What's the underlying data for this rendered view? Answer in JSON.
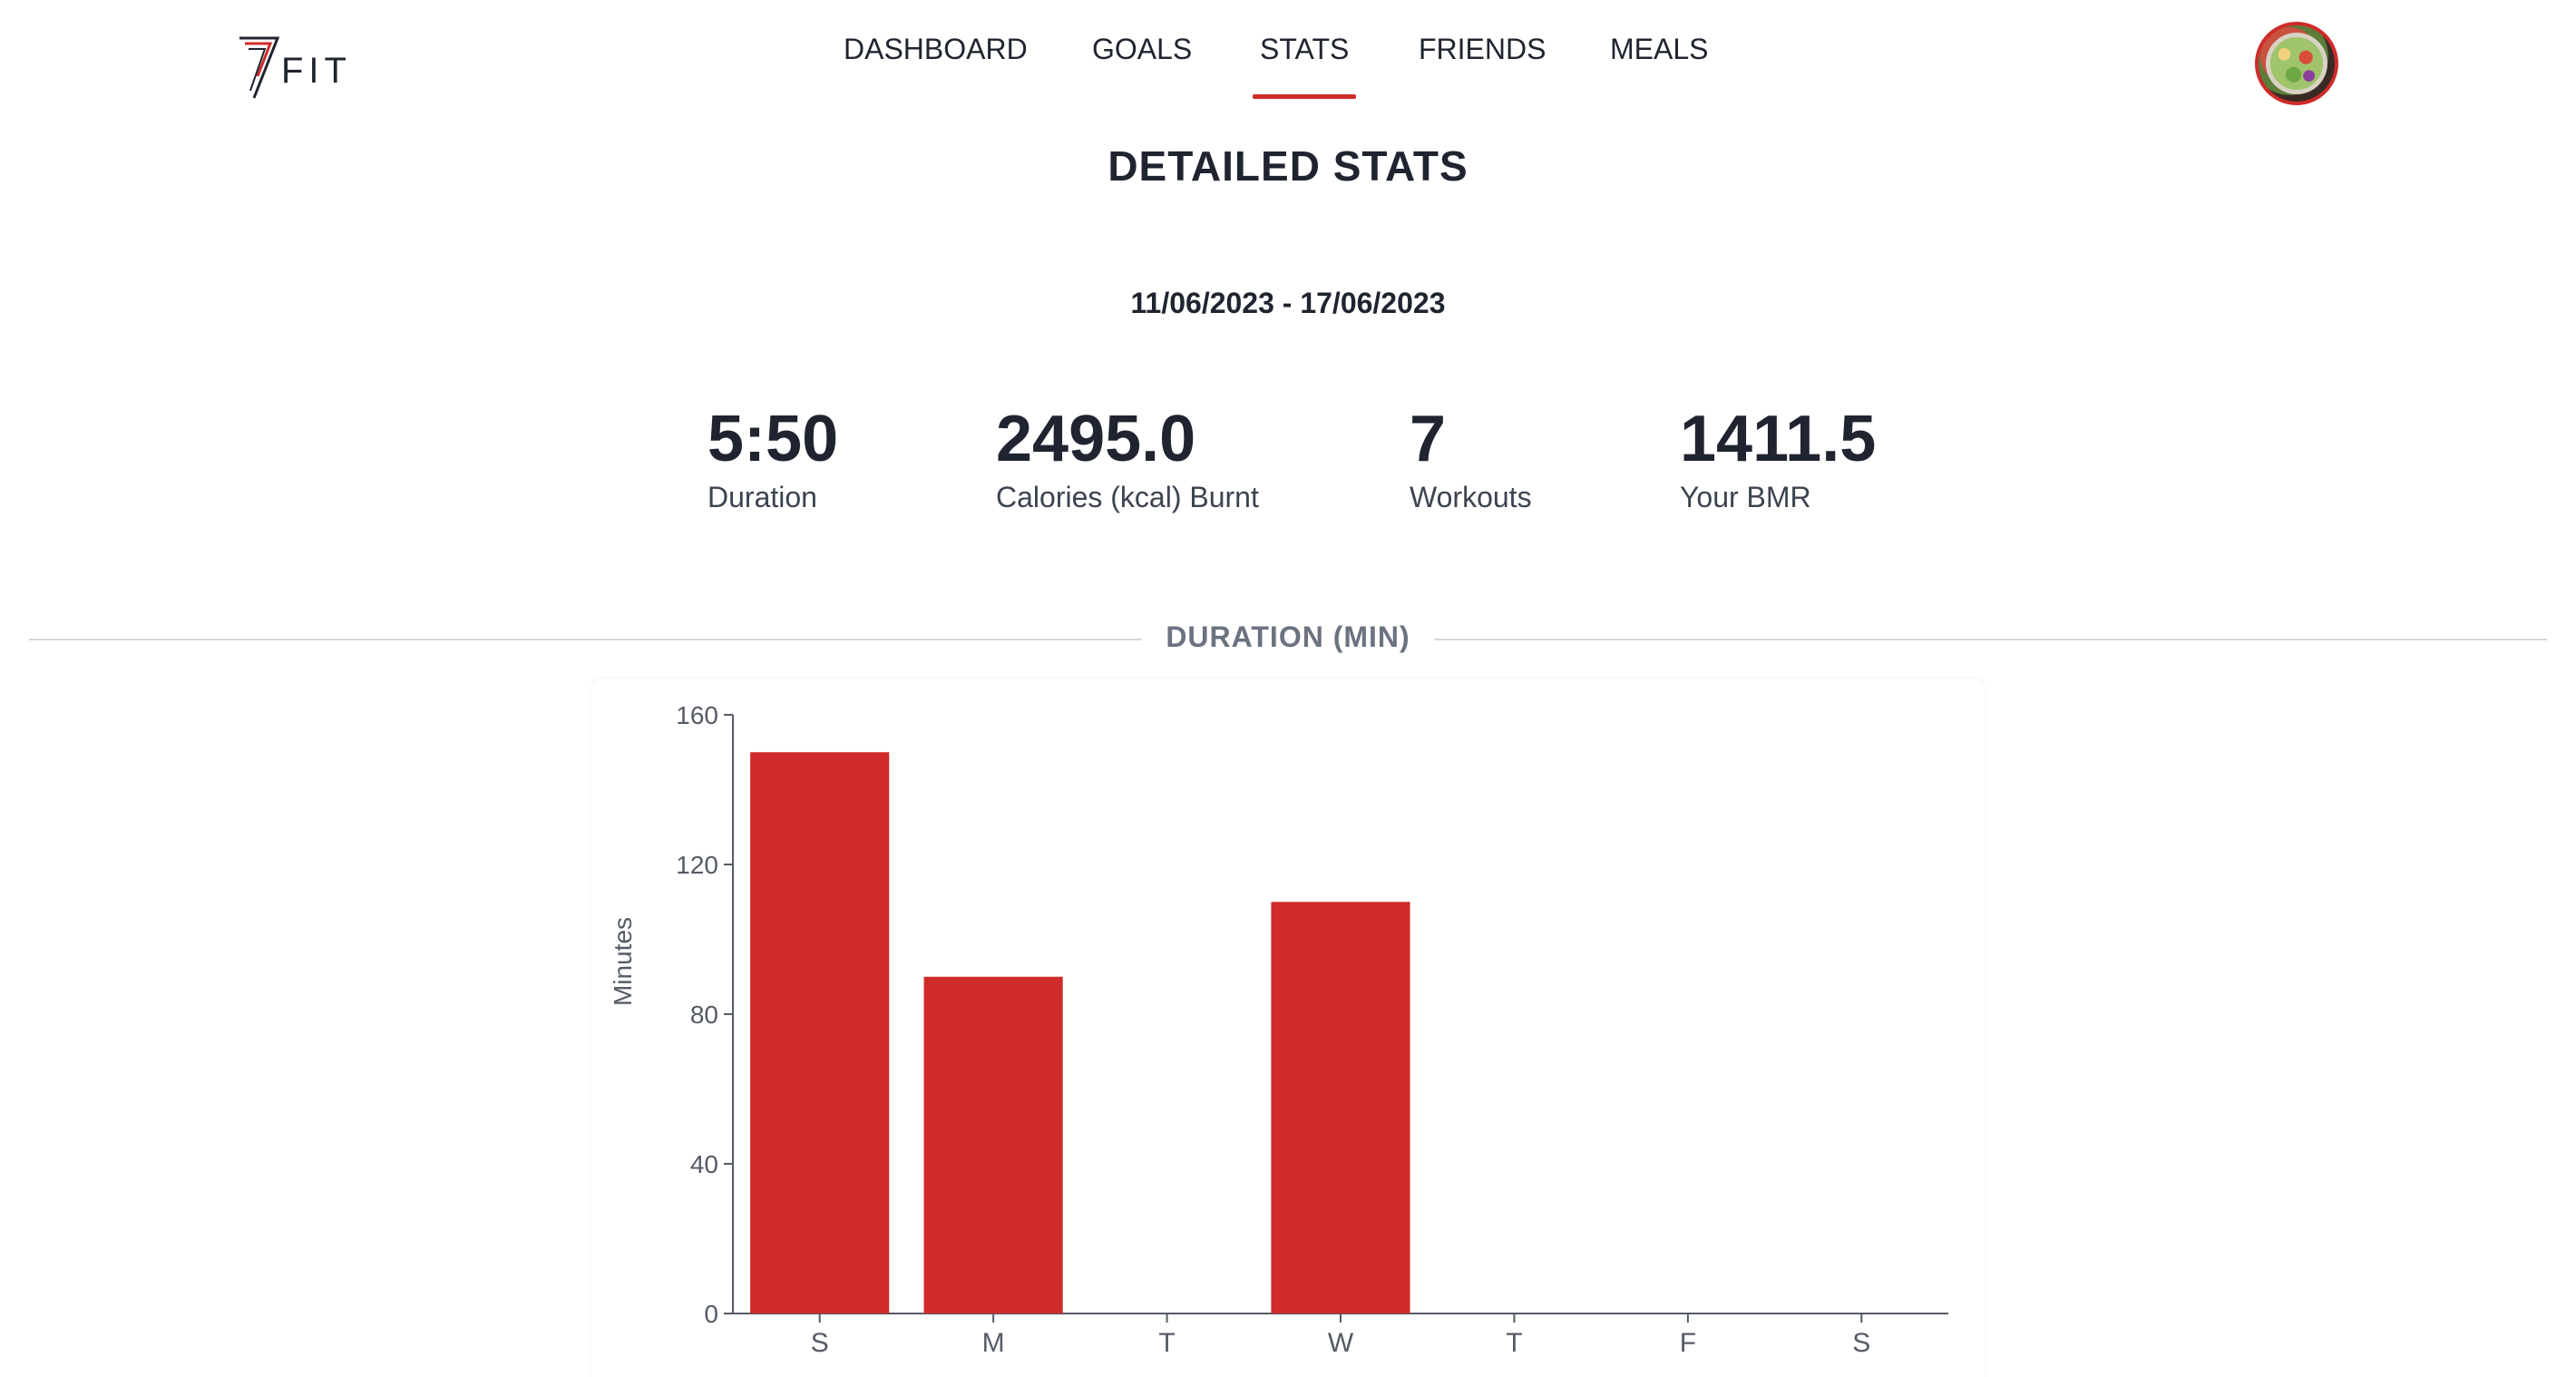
{
  "header": {
    "logo_text": "FIT",
    "nav": [
      {
        "label": "DASHBOARD",
        "active": false
      },
      {
        "label": "GOALS",
        "active": false
      },
      {
        "label": "STATS",
        "active": true
      },
      {
        "label": "FRIENDS",
        "active": false
      },
      {
        "label": "MEALS",
        "active": false
      }
    ],
    "accent_color": "#cf2b2a"
  },
  "page_title": "DETAILED STATS",
  "date_range": "11/06/2023 - 17/06/2023",
  "stats": [
    {
      "value": "5:50",
      "label": "Duration"
    },
    {
      "value": "2495.0",
      "label": "Calories (kcal) Burnt"
    },
    {
      "value": "7",
      "label": "Workouts"
    },
    {
      "value": "1411.5",
      "label": "Your BMR"
    }
  ],
  "section_title": "DURATION (MIN)",
  "chart_data": {
    "type": "bar",
    "categories": [
      "S",
      "M",
      "T",
      "W",
      "T",
      "F",
      "S"
    ],
    "values": [
      150,
      90,
      0,
      110,
      0,
      0,
      0
    ],
    "ylabel": "Minutes",
    "xlabel": "",
    "ylim": [
      0,
      160
    ],
    "yticks": [
      "0",
      "40",
      "80",
      "120",
      "160"
    ],
    "bar_color": "#cf2b2a",
    "grid": false
  }
}
